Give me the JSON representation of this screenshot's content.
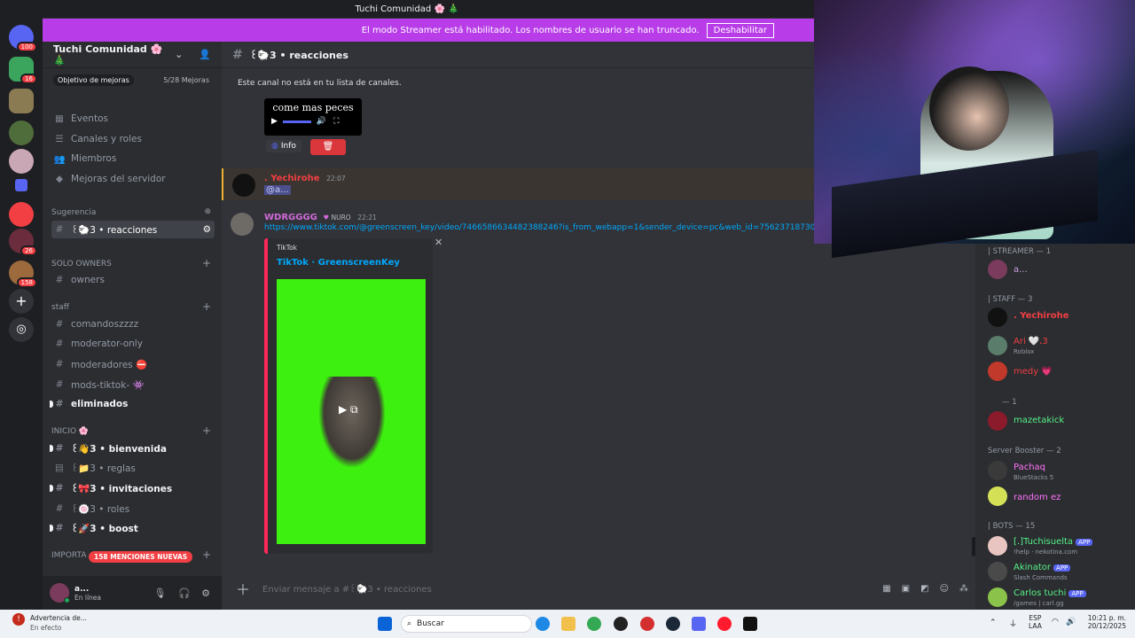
{
  "titlebar": {
    "title": "Tuchi Comunidad 🌸 🎄"
  },
  "banner": {
    "text": "El modo Streamer está habilitado. Los nombres de usuario se han truncado.",
    "button": "Deshabilitar"
  },
  "servers": {
    "badges": [
      "100",
      "16",
      "26",
      "158"
    ]
  },
  "server": {
    "name": "Tuchi Comunidad 🌸 🎄",
    "boost_goal": "Objetivo de mejoras",
    "boost_count": "5/28 Mejoras"
  },
  "nav": {
    "events": "Eventos",
    "channels_roles": "Canales y roles",
    "members": "Miembros",
    "boosts": "Mejoras del servidor"
  },
  "categories": {
    "suggestion": "Sugerencia",
    "solo_owners": "SOLO OWNERS",
    "staff": "staff",
    "inicio": "INICIO 🌸",
    "importa": "IMPORTA"
  },
  "channels": {
    "reacciones": "꒰🐑3 • reacciones",
    "owners": "owners",
    "comandos": "comandoszzzz",
    "modonly": "moderator-only",
    "moderadores": "moderadores ⛔",
    "modstiktok": "mods-tiktok- 👾",
    "eliminados": "eliminados",
    "bienvenida": "꒰👋3 • bienvenida",
    "reglas": "꒰📁3 • reglas",
    "invitaciones": "꒰🎀3 • invitaciones",
    "roles": "꒰🍥3 • roles",
    "boost": "꒰🚀3 • boost"
  },
  "mentions_badge": "158 MENCIONES NUEVAS",
  "user": {
    "name": "a...",
    "status": "En línea"
  },
  "header": {
    "channel": "꒰🐑3 • reacciones"
  },
  "main": {
    "note": "Este canal no está en tu lista de canales.",
    "embed_caption": "come mas peces",
    "info_button": "Info",
    "msg1": {
      "name": ". Yechirohe",
      "time": "22:07",
      "text": "@a..."
    },
    "msg2": {
      "name": "WDRGGGG",
      "tag": "NURO",
      "time": "22:21",
      "link": "https://www.tiktok.com/@greenscreen_key/video/7466586634482388246?is_from_webapp=1&sender_device=pc&web_id=75623718730",
      "provider": "TikTok",
      "embed_title": "TikTok · GreenscreenKey"
    }
  },
  "composer": {
    "placeholder": "Enviar mensaje a #꒰🐑3 • reacciones"
  },
  "members": {
    "streamer_cat": "| STREAMER — 1",
    "staff_cat": "| STAFF — 3",
    "one_cat": "— 1",
    "booster_cat": "Server Booster — 2",
    "bots_cat": "| BOTS — 15",
    "list": [
      {
        "name": "a...",
        "sub": ""
      },
      {
        "name": ". Yechirohe",
        "sub": ""
      },
      {
        "name": "Ari 🤍ꓸ3",
        "sub": "Roblox"
      },
      {
        "name": "medy 💗",
        "sub": ""
      },
      {
        "name": "mazetakick",
        "sub": ""
      },
      {
        "name": "Pachaq",
        "sub": "BlueStacks 5"
      },
      {
        "name": "random ez",
        "sub": ""
      },
      {
        "name": "[.]Tuchisuelta",
        "sub": "!help · nekotina.com",
        "tag": "APP"
      },
      {
        "name": "Akinator",
        "sub": "Slash Commands",
        "tag": "APP"
      },
      {
        "name": "Carlos tuchi",
        "sub": "/games | carl.gg",
        "tag": "APP"
      }
    ]
  },
  "taskbar": {
    "warning_title": "Advertencia de...",
    "warning_sub": "En efecto",
    "search": "Buscar",
    "lang": "ESP",
    "lang2": "LAA",
    "time": "10:21 p. m.",
    "date": "20/12/2025"
  },
  "colors": {
    "accent": "#b83ce8",
    "green": "#23a559",
    "red": "#f23f43",
    "blurple": "#5865f2"
  }
}
